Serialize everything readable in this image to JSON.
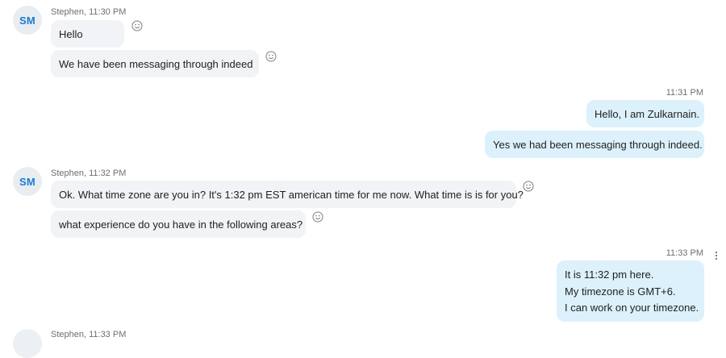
{
  "chat": {
    "groups": [
      {
        "avatar": "SM",
        "meta": "Stephen, 11:30 PM",
        "messages": [
          "Hello",
          "We have been messaging through indeed"
        ]
      },
      {
        "time": "11:31 PM",
        "messages": [
          "Hello, I am Zulkarnain.",
          "Yes we had been messaging through indeed."
        ]
      },
      {
        "avatar": "SM",
        "meta": "Stephen, 11:32 PM",
        "messages": [
          "Ok. What time zone are you in? It's 1:32 pm EST american time for me now. What time is is for you?",
          "what experience do you have in the following areas?"
        ]
      },
      {
        "time": "11:33 PM",
        "lines": [
          "It is 11:32 pm here.",
          "My timezone is GMT+6.",
          "I can work on your timezone."
        ]
      },
      {
        "meta": "Stephen, 11:33 PM"
      }
    ]
  },
  "icons": {
    "reaction": "smiley-reaction-icon",
    "more": "more-options-icon"
  },
  "colors": {
    "incoming_bubble": "#f1f3f6",
    "outgoing_bubble": "#dcf1fb",
    "avatar_text": "#1e7ad2",
    "avatar_bg": "#e8edf2"
  }
}
